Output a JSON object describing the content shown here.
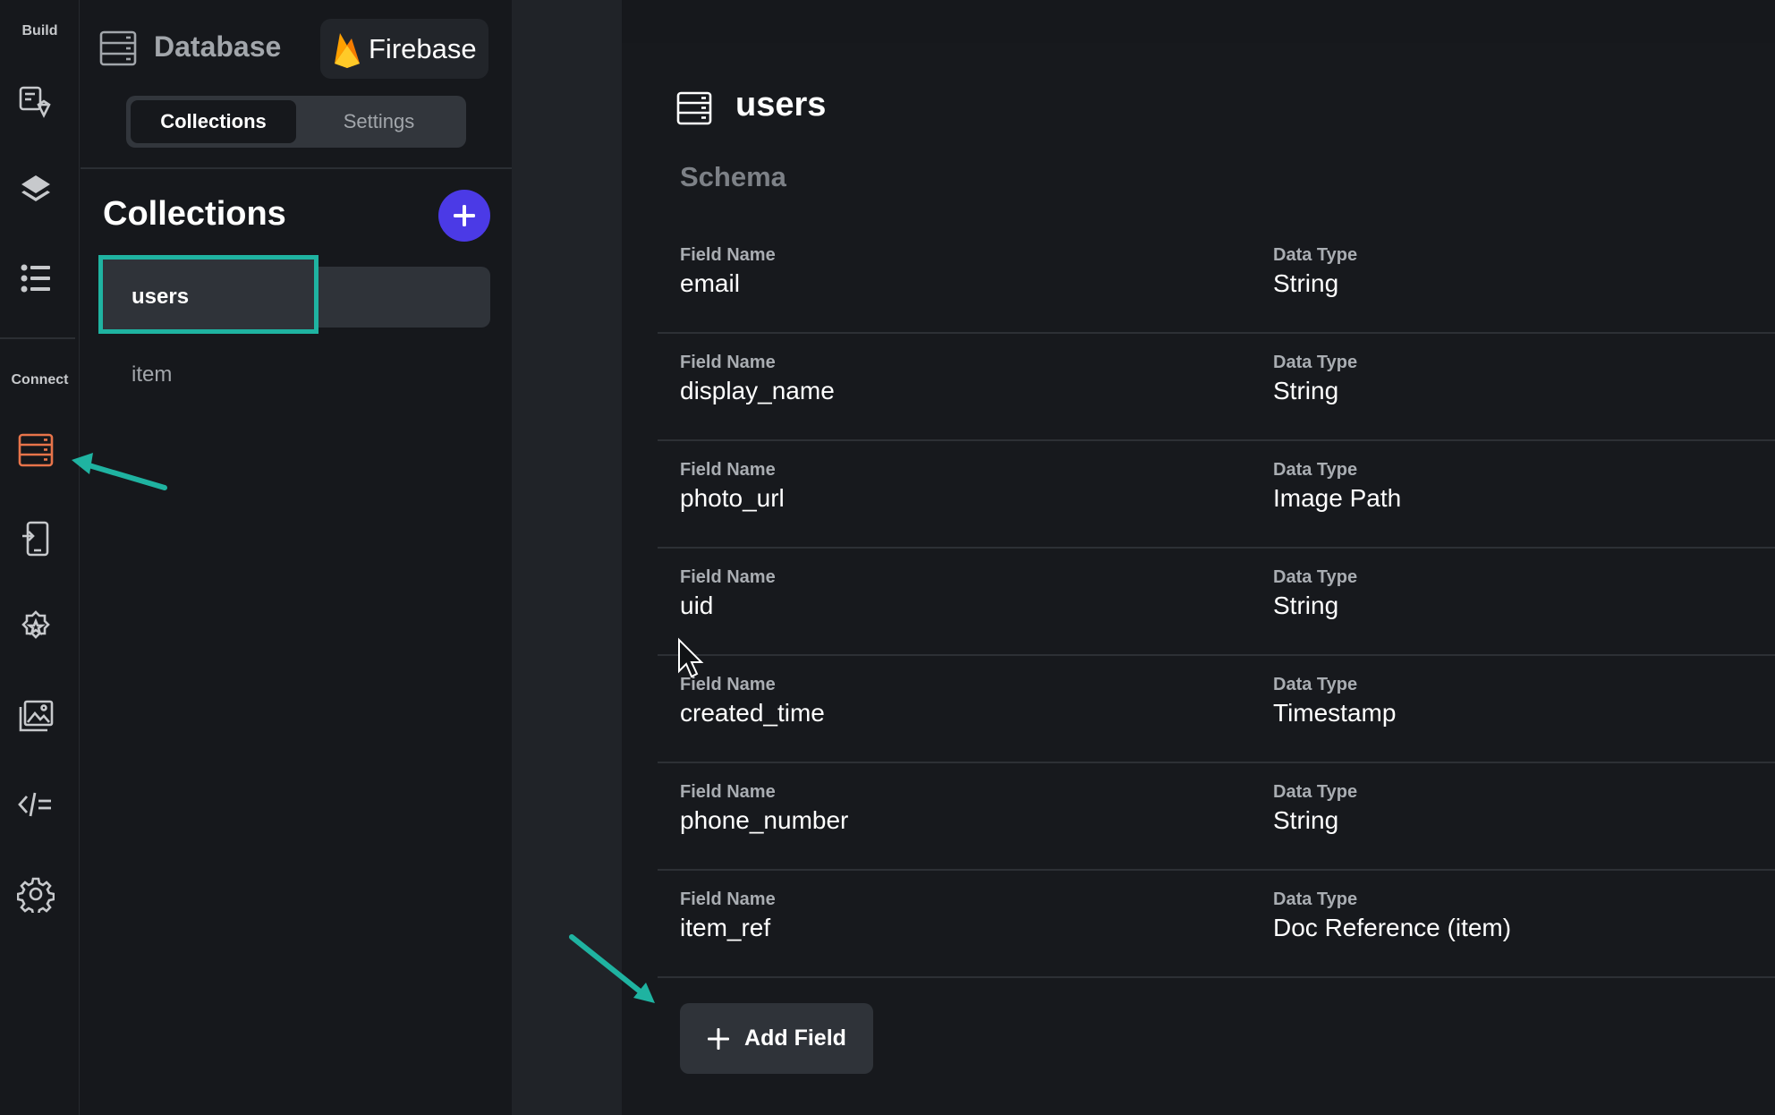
{
  "rail": {
    "build_label": "Build",
    "connect_label": "Connect",
    "icons": [
      "widget-palette-icon",
      "layers-icon",
      "list-icon",
      "database-icon",
      "app-details-icon",
      "integrations-gear-icon",
      "media-assets-icon",
      "custom-code-icon",
      "settings-gear-icon"
    ],
    "active_color": "#e8744a"
  },
  "panel": {
    "header_title": "Database",
    "provider": "Firebase",
    "tabs": [
      {
        "label": "Collections",
        "active": true
      },
      {
        "label": "Settings",
        "active": false
      }
    ],
    "section_title": "Collections",
    "collections": [
      {
        "name": "users",
        "selected": true
      },
      {
        "name": "item",
        "selected": false
      }
    ],
    "highlight_color": "#1fb3a1"
  },
  "main": {
    "title": "users",
    "schema_label": "Schema",
    "field_name_label": "Field Name",
    "data_type_label": "Data Type",
    "fields": [
      {
        "name": "email",
        "type": "String"
      },
      {
        "name": "display_name",
        "type": "String"
      },
      {
        "name": "photo_url",
        "type": "Image Path"
      },
      {
        "name": "uid",
        "type": "String"
      },
      {
        "name": "created_time",
        "type": "Timestamp"
      },
      {
        "name": "phone_number",
        "type": "String"
      },
      {
        "name": "item_ref",
        "type": "Doc Reference (item)"
      }
    ],
    "add_field_label": "Add Field"
  },
  "colors": {
    "accent_purple": "#4b3ae6",
    "annotation_teal": "#1fb3a1"
  }
}
